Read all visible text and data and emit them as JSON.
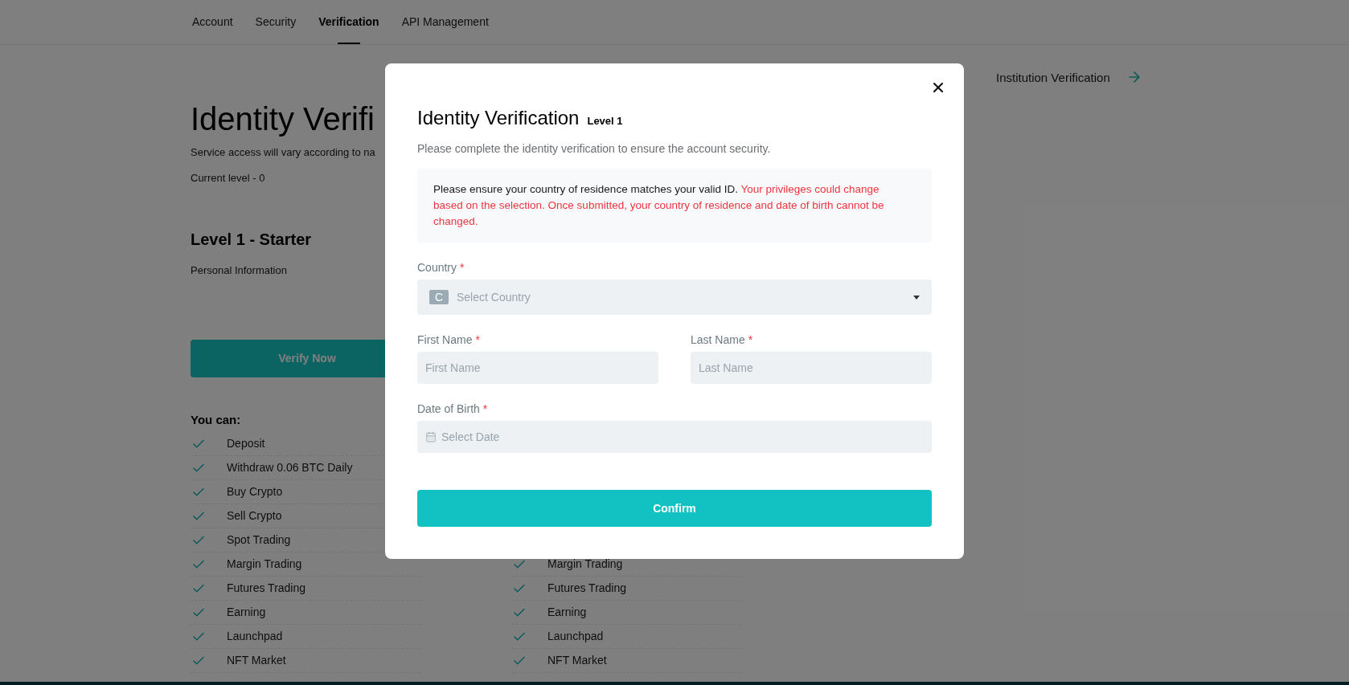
{
  "tabs": [
    {
      "label": "Account",
      "selected": false
    },
    {
      "label": "Security",
      "selected": false
    },
    {
      "label": "Verification",
      "selected": true
    },
    {
      "label": "API Management",
      "selected": false
    }
  ],
  "page": {
    "title": "Identity Verifi",
    "subtitle": "Service access will vary according to na",
    "current_level": "Current level - 0",
    "institution_link": "Institution Verification",
    "level_title": "Level 1 - Starter",
    "level_subtitle": "Personal Information",
    "verify_button": "Verify Now",
    "you_can": "You can:",
    "left_items": [
      "Deposit",
      "Withdraw 0.06 BTC Daily",
      "Buy Crypto",
      "Sell Crypto",
      "Spot Trading",
      "Margin Trading",
      "Futures Trading",
      "Earning",
      "Launchpad",
      "NFT Market"
    ],
    "right_items": [
      "Margin Trading",
      "Futures Trading",
      "Earning",
      "Launchpad",
      "NFT Market"
    ]
  },
  "modal": {
    "title": "Identity Verification",
    "level": "Level 1",
    "description": "Please complete the identity verification to ensure the account security.",
    "notice": {
      "text": "Please ensure your country of residence matches your valid ID.",
      "warning": "Your privileges could change based on the selection. Once submitted, your country of residence and date of birth cannot be changed."
    },
    "field_rows": [
      {
        "fields": [
          {
            "kind": "select",
            "label": "Country",
            "required_mark": "*",
            "badge": "C",
            "placeholder": "Select Country"
          }
        ]
      },
      {
        "fields": [
          {
            "kind": "text",
            "label": "First Name",
            "required_mark": "*",
            "placeholder": "First Name"
          },
          {
            "kind": "text",
            "label": "Last Name",
            "required_mark": "*",
            "placeholder": "Last Name"
          }
        ]
      },
      {
        "fields": [
          {
            "kind": "date",
            "label": "Date of Birth",
            "required_mark": "*",
            "placeholder": "Select Date"
          }
        ]
      }
    ],
    "confirm": "Confirm"
  }
}
